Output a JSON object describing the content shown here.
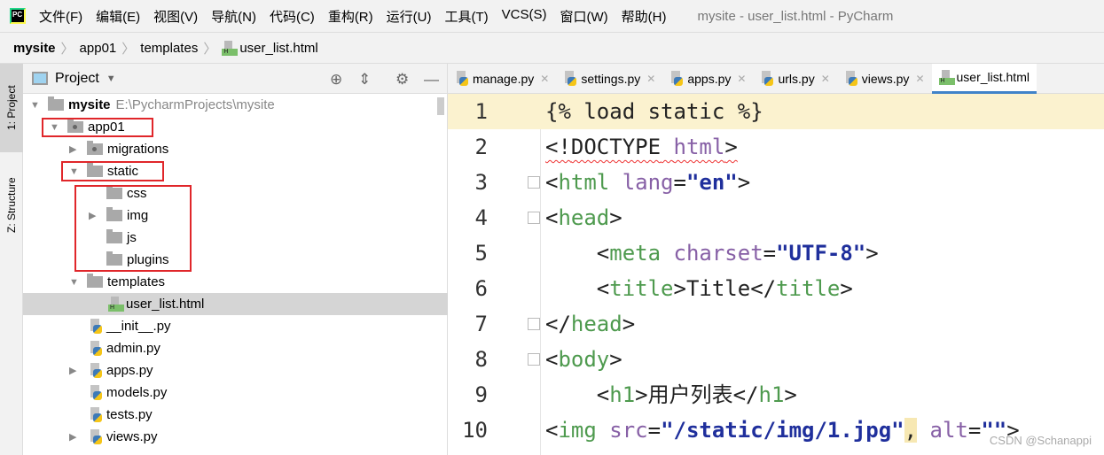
{
  "titlebar": {
    "logo": "PC",
    "menu": [
      "文件(F)",
      "编辑(E)",
      "视图(V)",
      "导航(N)",
      "代码(C)",
      "重构(R)",
      "运行(U)",
      "工具(T)",
      "VCS(S)",
      "窗口(W)",
      "帮助(H)"
    ],
    "title": "mysite - user_list.html - PyCharm"
  },
  "breadcrumb": [
    "mysite",
    "app01",
    "templates",
    "user_list.html"
  ],
  "leftstrip": {
    "project_tab": "1: Project",
    "structure_tab": "Z: Structure"
  },
  "panel": {
    "title": "Project",
    "tools": [
      "locate-icon",
      "collapse-icon",
      "gear-icon",
      "minimize-icon"
    ]
  },
  "tree": [
    {
      "name": "mysite",
      "path": "E:\\PycharmProjects\\mysite",
      "type": "folder",
      "expanded": true
    },
    {
      "name": "app01",
      "type": "module",
      "expanded": true
    },
    {
      "name": "migrations",
      "type": "module",
      "expanded": false
    },
    {
      "name": "static",
      "type": "folder",
      "expanded": true
    },
    {
      "name": "css",
      "type": "folder"
    },
    {
      "name": "img",
      "type": "folder",
      "expanded": false
    },
    {
      "name": "js",
      "type": "folder"
    },
    {
      "name": "plugins",
      "type": "folder"
    },
    {
      "name": "templates",
      "type": "folder",
      "expanded": true
    },
    {
      "name": "user_list.html",
      "type": "html",
      "selected": true
    },
    {
      "name": "__init__.py",
      "type": "py"
    },
    {
      "name": "admin.py",
      "type": "py"
    },
    {
      "name": "apps.py",
      "type": "py",
      "expanded": false
    },
    {
      "name": "models.py",
      "type": "py"
    },
    {
      "name": "tests.py",
      "type": "py"
    },
    {
      "name": "views.py",
      "type": "py",
      "expanded": false
    }
  ],
  "tabs": [
    "manage.py",
    "settings.py",
    "apps.py",
    "urls.py",
    "views.py",
    "user_list.html"
  ],
  "active_tab": "user_list.html",
  "code": [
    {
      "n": "1",
      "text": "{% load static %}"
    },
    {
      "n": "2",
      "text": "<!DOCTYPE html>"
    },
    {
      "n": "3",
      "text": "<html lang=\"en\">"
    },
    {
      "n": "4",
      "text": "<head>"
    },
    {
      "n": "5",
      "text": "    <meta charset=\"UTF-8\">"
    },
    {
      "n": "6",
      "text": "    <title>Title</title>"
    },
    {
      "n": "7",
      "text": "</head>"
    },
    {
      "n": "8",
      "text": "<body>"
    },
    {
      "n": "9",
      "text": "    <h1>用户列表</h1>"
    },
    {
      "n": "10",
      "text": "<img src=\"/static/img/1.jpg\", alt=\"\">"
    }
  ],
  "watermark": "CSDN @Schanappi",
  "colors": {
    "highlight_box": "#e0262a",
    "current_line": "#fbf2cf",
    "tag": "#4e9a4e",
    "attr": "#8760a6",
    "string": "#1f2f9c"
  }
}
